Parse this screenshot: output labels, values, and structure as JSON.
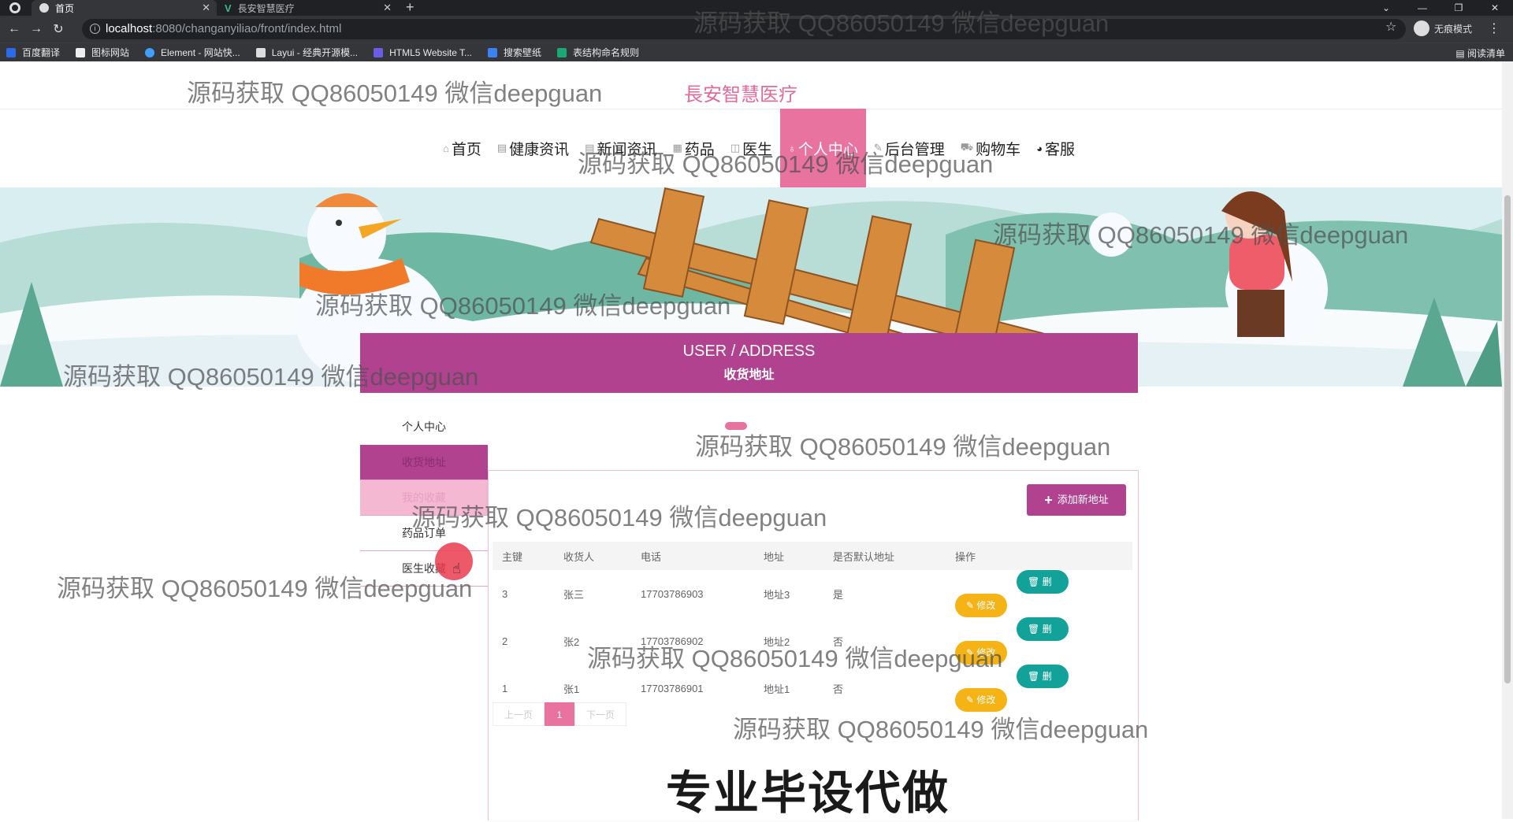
{
  "browser": {
    "tabs": [
      {
        "title": "首页",
        "active": true
      },
      {
        "title": "長安智慧医疗",
        "active": false
      }
    ],
    "url_host": "localhost",
    "url_path": ":8080/changanyiliao/front/index.html",
    "incognito_label": "无痕模式",
    "reading_list": "阅读清单",
    "bookmarks": [
      "百度翻译",
      "图标网站",
      "Element - 网站快...",
      "Layui - 经典开源模...",
      "HTML5 Website T...",
      "搜索壁纸",
      "表结构命名规则"
    ]
  },
  "site": {
    "title": "長安智慧医疗"
  },
  "nav": [
    {
      "label": "首页",
      "icon": "⌂",
      "active": false
    },
    {
      "label": "健康资讯",
      "icon": "▤",
      "active": false
    },
    {
      "label": "新闻资讯",
      "icon": "▤",
      "active": false
    },
    {
      "label": "药品",
      "icon": "▦",
      "active": false
    },
    {
      "label": "医生",
      "icon": "◫",
      "active": false
    },
    {
      "label": "个人中心",
      "icon": "♁",
      "active": true
    },
    {
      "label": "后台管理",
      "icon": "✎",
      "active": false
    },
    {
      "label": "购物车",
      "icon": "⛟",
      "active": false
    },
    {
      "label": "客服",
      "icon": "◕",
      "active": false
    }
  ],
  "section": {
    "title_en": "USER / ADDRESS",
    "title_cn": "收货地址"
  },
  "sidebar": {
    "header": "个人中心",
    "items": [
      {
        "label": "收货地址",
        "state": "active"
      },
      {
        "label": "我的收藏",
        "state": "hover"
      },
      {
        "label": "药品订单",
        "state": "normal"
      },
      {
        "label": "医生收藏",
        "state": "normal"
      }
    ]
  },
  "panel": {
    "add_button": "添加新地址",
    "columns": [
      "主键",
      "收货人",
      "电话",
      "地址",
      "是否默认地址",
      "操作"
    ],
    "rows": [
      {
        "id": "3",
        "name": "张三",
        "phone": "17703786903",
        "address": "地址3",
        "default": "是"
      },
      {
        "id": "2",
        "name": "张2",
        "phone": "17703786902",
        "address": "地址2",
        "default": "否"
      },
      {
        "id": "1",
        "name": "张1",
        "phone": "17703786901",
        "address": "地址1",
        "default": "否"
      }
    ],
    "edit_label": "修改",
    "delete_label": "删除",
    "pager": {
      "prev": "上一页",
      "current": "1",
      "next": "下一页"
    }
  },
  "promo_text": "专业毕设代做",
  "watermark": "源码获取 QQ86050149 微信deepguan",
  "colors": {
    "accent": "#b0428f",
    "pink": "#e8739f",
    "edit": "#f5b316",
    "delete": "#13a29a"
  }
}
